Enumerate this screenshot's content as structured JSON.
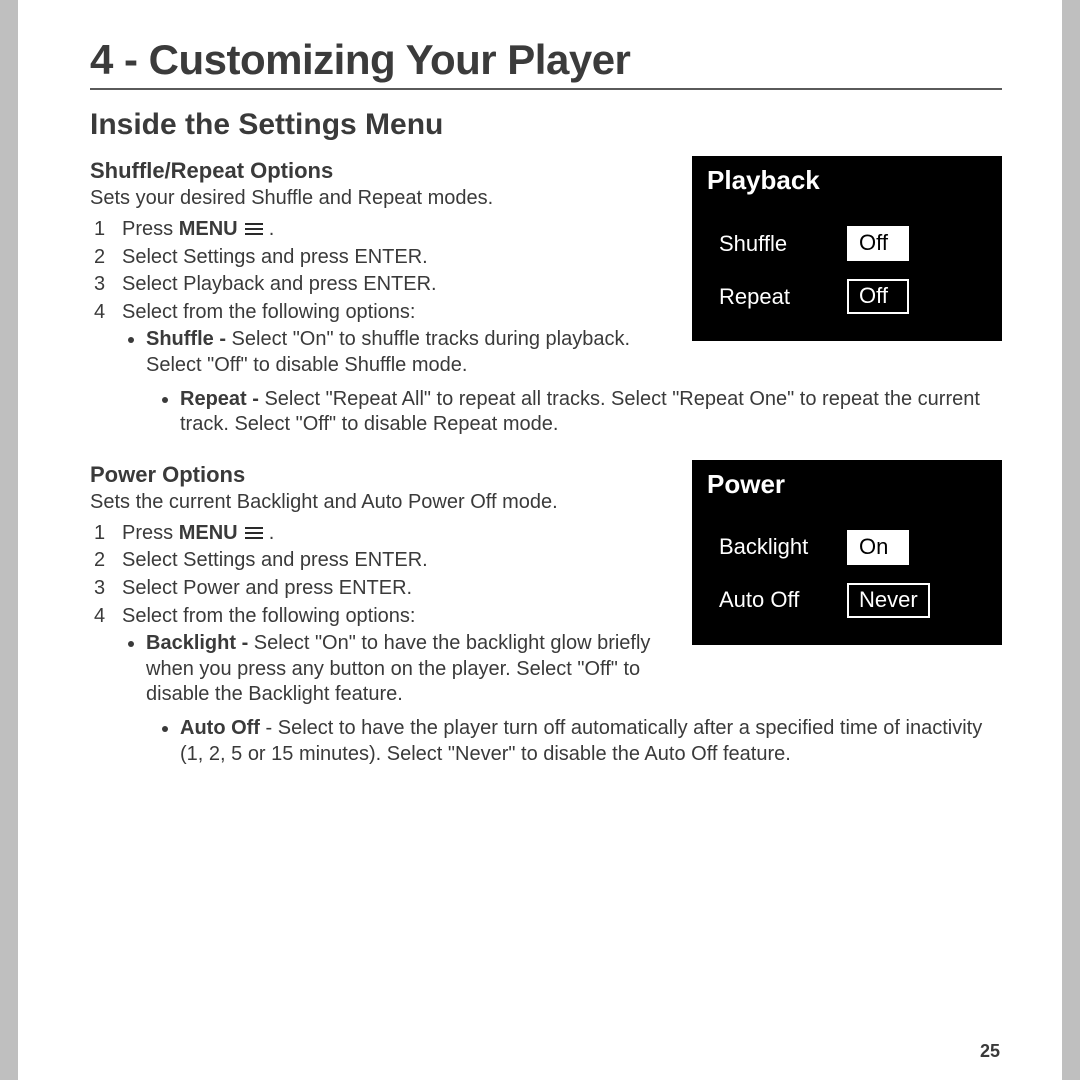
{
  "chapter_title": "4 - Customizing Your Player",
  "section_title": "Inside the Settings Menu",
  "page_number": "25",
  "shuffle": {
    "heading": "Shuffle/Repeat Options",
    "intro": "Sets your desired Shuffle and Repeat modes.",
    "steps": {
      "s1_a": "Press ",
      "s1_b": "MENU",
      "s1_c": " .",
      "s2": "Select Settings and press ENTER.",
      "s3": "Select Playback and press ENTER.",
      "s4": "Select from the following options:"
    },
    "opt_shuffle_label": "Shuffle - ",
    "opt_shuffle_text_a": "Select \"On\" to shuffle tracks during playback. Select \"Off\" to disable Shuffle mode.",
    "opt_repeat_label": "Repeat - ",
    "opt_repeat_text": "Select \"Repeat All\" to repeat all tracks. Select \"Repeat One\" to repeat the current track. Select \"Off\" to disable Repeat mode."
  },
  "power": {
    "heading": "Power Options",
    "intro": "Sets the current Backlight and Auto Power Off mode.",
    "steps": {
      "s1_a": "Press ",
      "s1_b": "MENU",
      "s1_c": " .",
      "s2": "Select Settings and press ENTER.",
      "s3": "Select Power and press ENTER.",
      "s4": "Select from the following options:"
    },
    "opt_backlight_label": "Backlight - ",
    "opt_backlight_text": "Select \"On\" to have the backlight glow briefly when you press any button on the player. Select \"Off\" to disable the Backlight feature.",
    "opt_autooff_label": "Auto Off",
    "opt_autooff_text": " - Select to have the player turn off automatically after a specified time of inactivity (1, 2, 5 or 15 minutes). Select \"Never\" to disable the Auto Off feature."
  },
  "fig_playback": {
    "title": "Playback",
    "rows": [
      {
        "label": "Shuffle",
        "value": "Off",
        "selected": true
      },
      {
        "label": "Repeat",
        "value": "Off",
        "selected": false
      }
    ]
  },
  "fig_power": {
    "title": "Power",
    "rows": [
      {
        "label": "Backlight",
        "value": "On",
        "selected": true
      },
      {
        "label": "Auto Off",
        "value": "Never",
        "selected": false
      }
    ]
  }
}
